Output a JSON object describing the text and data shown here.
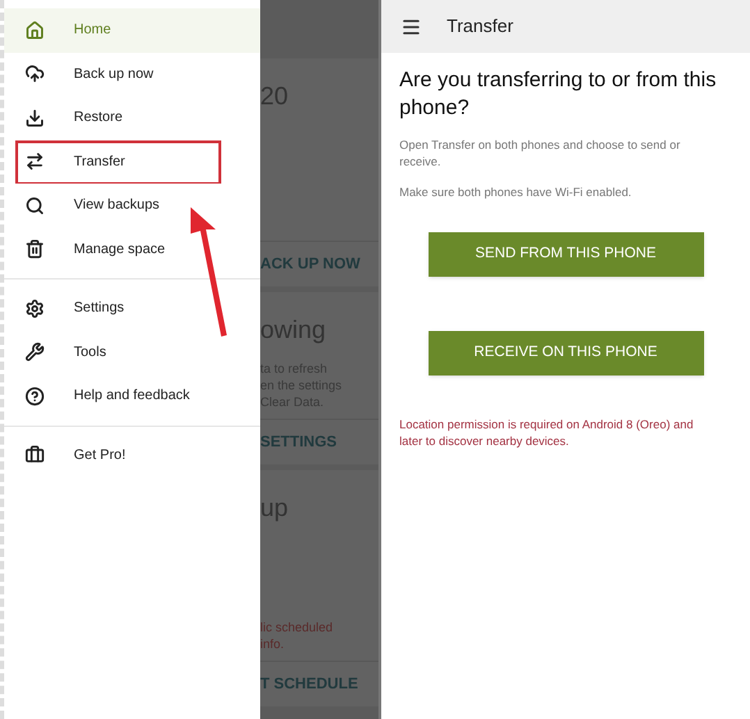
{
  "drawer": {
    "sections": [
      {
        "items": [
          {
            "label": "Home",
            "selected": true,
            "highlighted": false
          },
          {
            "label": "Back up now",
            "selected": false,
            "highlighted": false
          },
          {
            "label": "Restore",
            "selected": false,
            "highlighted": false
          },
          {
            "label": "Transfer",
            "selected": false,
            "highlighted": true
          },
          {
            "label": "View backups",
            "selected": false,
            "highlighted": false
          },
          {
            "label": "Manage space",
            "selected": false,
            "highlighted": false
          }
        ]
      },
      {
        "items": [
          {
            "label": "Settings",
            "selected": false,
            "highlighted": false
          },
          {
            "label": "Tools",
            "selected": false,
            "highlighted": false
          },
          {
            "label": "Help and feedback",
            "selected": false,
            "highlighted": false
          }
        ]
      },
      {
        "items": [
          {
            "label": "Get Pro!",
            "selected": false,
            "highlighted": false
          }
        ]
      }
    ]
  },
  "background_screen": {
    "cards": [
      {
        "title": "20",
        "button": "ACK UP NOW"
      },
      {
        "title": "owing",
        "lines": [
          "ta to refresh",
          "en the settings",
          "Clear Data."
        ],
        "button": "SETTINGS"
      },
      {
        "title": "up",
        "note": [
          "lic scheduled",
          "info."
        ],
        "button": "T SCHEDULE"
      }
    ]
  },
  "transfer_screen": {
    "title": "Transfer",
    "question": "Are you transferring to or from this phone?",
    "paragraphs": [
      "Open Transfer on both phones and choose to send or receive.",
      "Make sure both phones have Wi-Fi enabled."
    ],
    "buttons": [
      "SEND FROM THIS PHONE",
      "RECEIVE ON THIS PHONE"
    ],
    "warning": "Location permission is required on Android 8 (Oreo) and later to discover nearby devices."
  }
}
